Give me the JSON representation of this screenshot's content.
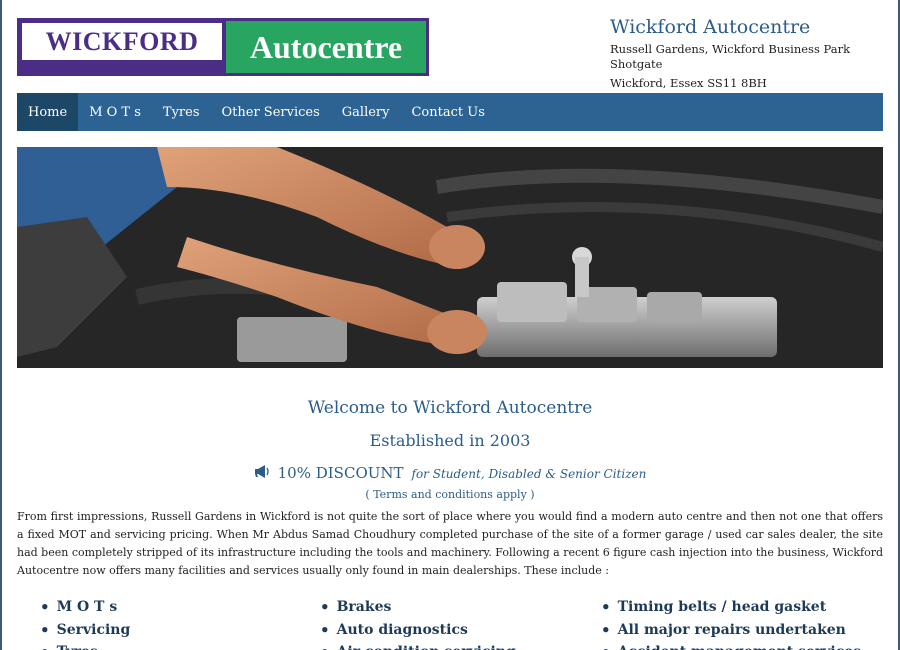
{
  "logo": {
    "left_text": "WICKFORD",
    "right_text": "Autocentre"
  },
  "header": {
    "title": "Wickford Autocentre",
    "address_line1": "Russell Gardens, Wickford Business Park Shotgate",
    "address_line2": "Wickford, Essex SS11 8BH"
  },
  "nav": {
    "items": [
      {
        "label": "Home"
      },
      {
        "label": "M O T s"
      },
      {
        "label": "Tyres"
      },
      {
        "label": "Other Services"
      },
      {
        "label": "Gallery"
      },
      {
        "label": "Contact Us"
      }
    ],
    "active": "Home"
  },
  "content": {
    "welcome": "Welcome to Wickford Autocentre",
    "established": "Established in 2003",
    "discount_percent": "10% DISCOUNT",
    "discount_for": "for Student, Disabled & Senior Citizen",
    "terms": "( Terms and conditions apply )",
    "intro": "From first impressions, Russell Gardens in Wickford is not quite the sort of place where you would find a modern auto centre and then not one that offers a fixed MOT and servicing pricing. When Mr Abdus Samad Choudhury completed purchase of the site of a former garage / used car sales dealer, the site had been completely stripped of its infrastructure including the tools and machinery. Following a recent 6 figure cash injection into the business, Wickford Autocentre now offers many facilities and services usually only found in main dealerships. These include :"
  },
  "services": {
    "col1": [
      "M O T s",
      "Servicing",
      "Tyres"
    ],
    "col2": [
      "Brakes",
      "Auto diagnostics",
      "Air condition servicing"
    ],
    "col3": [
      "Timing belts / head gasket",
      "All major repairs undertaken",
      "Accident management services"
    ]
  },
  "colors": {
    "brand_purple": "#4b2d86",
    "brand_green": "#27a561",
    "nav_blue": "#2d6392",
    "accent_text": "#2b5d8a"
  },
  "icons": {
    "discount": "megaphone-icon"
  }
}
